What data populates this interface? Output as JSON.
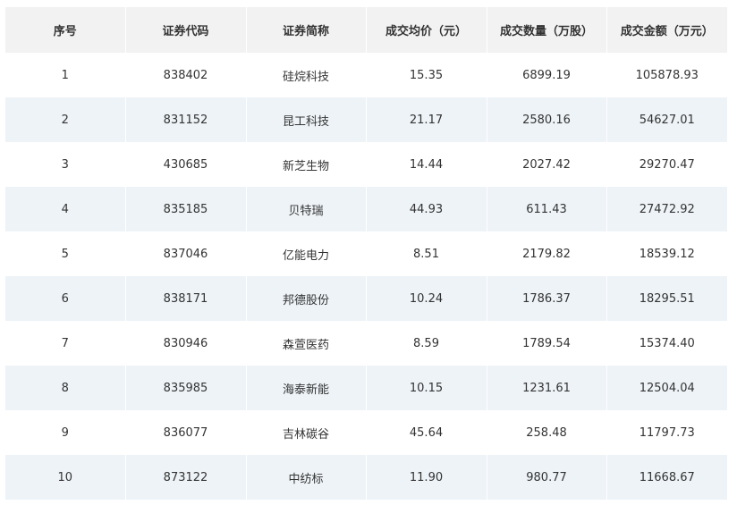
{
  "table": {
    "headers": [
      "序号",
      "证券代码",
      "证券简称",
      "成交均价（元）",
      "成交数量（万股）",
      "成交金额（万元）"
    ],
    "rows": [
      [
        "1",
        "838402",
        "硅烷科技",
        "15.35",
        "6899.19",
        "105878.93"
      ],
      [
        "2",
        "831152",
        "昆工科技",
        "21.17",
        "2580.16",
        "54627.01"
      ],
      [
        "3",
        "430685",
        "新芝生物",
        "14.44",
        "2027.42",
        "29270.47"
      ],
      [
        "4",
        "835185",
        "贝特瑞",
        "44.93",
        "611.43",
        "27472.92"
      ],
      [
        "5",
        "837046",
        "亿能电力",
        "8.51",
        "2179.82",
        "18539.12"
      ],
      [
        "6",
        "838171",
        "邦德股份",
        "10.24",
        "1786.37",
        "18295.51"
      ],
      [
        "7",
        "830946",
        "森萱医药",
        "8.59",
        "1789.54",
        "15374.40"
      ],
      [
        "8",
        "835985",
        "海泰新能",
        "10.15",
        "1231.61",
        "12504.04"
      ],
      [
        "9",
        "836077",
        "吉林碳谷",
        "45.64",
        "258.48",
        "11797.73"
      ],
      [
        "10",
        "873122",
        "中纺标",
        "11.90",
        "980.77",
        "11668.67"
      ]
    ]
  },
  "colors": {
    "header_bg": "#f2f2f2",
    "stripe_bg": "#eef3f7",
    "text": "#333333"
  }
}
